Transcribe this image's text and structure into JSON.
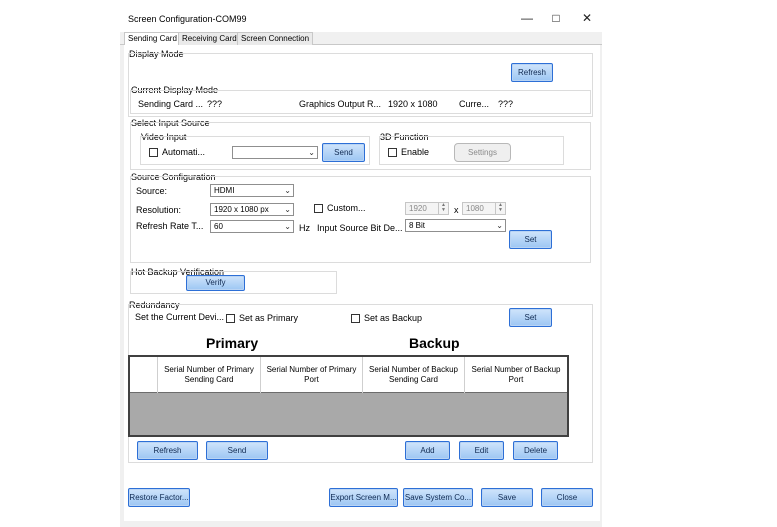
{
  "window": {
    "title": "Screen Configuration-COM99",
    "minimize_icon": "minimize-icon",
    "maximize_icon": "maximize-icon",
    "close_icon": "close-icon"
  },
  "tabs": [
    {
      "label": "Sending Card",
      "active": true
    },
    {
      "label": "Receiving Card",
      "active": false
    },
    {
      "label": "Screen Connection",
      "active": false
    }
  ],
  "display_mode": {
    "title": "Display Mode",
    "refresh_label": "Refresh",
    "current_title": "Current Display Mode",
    "sending_card_label": "Sending Card ...",
    "sending_card_value": "???",
    "graphics_output_label": "Graphics Output R...",
    "graphics_output_value": "1920 x 1080",
    "curre_label": "Curre...",
    "curre_value": "???"
  },
  "input_source": {
    "title": "Select Input Source",
    "video_input_title": "Video Input",
    "automatic_label": "Automati...",
    "automatic_checked": false,
    "video_select_value": "",
    "send_label": "Send",
    "function_3d_title": "3D Function",
    "enable_label": "Enable",
    "enable_checked": false,
    "settings_label": "Settings"
  },
  "source_config": {
    "title": "Source Configuration",
    "source_label": "Source:",
    "source_value": "HDMI",
    "resolution_label": "Resolution:",
    "resolution_value": "1920 x 1080 px",
    "custom_label": "Custom...",
    "custom_checked": false,
    "custom_width": "1920",
    "times_label": "x",
    "custom_height": "1080",
    "refresh_rate_label": "Refresh Rate T...",
    "refresh_rate_value": "60",
    "hz_label": "Hz",
    "bit_depth_label": "Input Source Bit De...",
    "bit_depth_value": "8 Bit",
    "set_label": "Set"
  },
  "hot_backup": {
    "title": "Hot Backup Verification",
    "verify_label": "Verify"
  },
  "redundancy": {
    "title": "Redundancy",
    "set_current_label": "Set the Current Devi...",
    "set_primary_label": "Set as Primary",
    "set_primary_checked": false,
    "set_backup_label": "Set as Backup",
    "set_backup_checked": false,
    "set_label": "Set",
    "primary_heading": "Primary",
    "backup_heading": "Backup",
    "columns": [
      "Serial Number of Primary Sending Card",
      "Serial Number of Primary Port",
      "Serial Number of Backup Sending Card",
      "Serial Number of Backup Port"
    ],
    "rows": [],
    "refresh_label": "Refresh",
    "send_label": "Send",
    "add_label": "Add",
    "edit_label": "Edit",
    "delete_label": "Delete"
  },
  "footer": {
    "restore_label": "Restore Factor...",
    "export_label": "Export Screen M...",
    "save_system_label": "Save System Co...",
    "save_label": "Save",
    "close_label": "Close"
  },
  "colors": {
    "accent_border": "#2d6fd6",
    "button_fill": "#9cc6f3",
    "window_bg": "#f0f0f0",
    "table_body": "#a9a9a9"
  }
}
